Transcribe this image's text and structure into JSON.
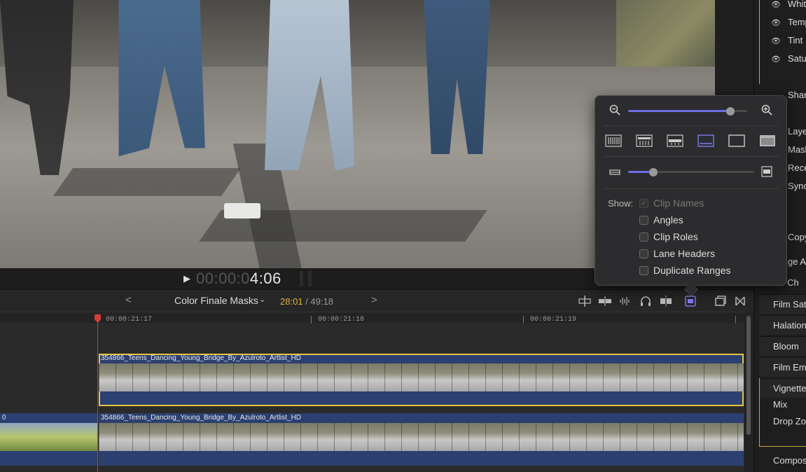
{
  "viewer": {
    "timecode_dim": "00:00:0",
    "timecode_bright": "4:06"
  },
  "toolbar": {
    "project_name": "Color Finale Masks",
    "duration_current": "28:01",
    "duration_separator": " / ",
    "duration_total": "49:18",
    "back_arrow": "<",
    "forward_arrow": ">",
    "chevron": "⌄"
  },
  "timeline": {
    "ruler": [
      "00:00:21:17",
      "00:00:21:18",
      "00:00:21:19"
    ],
    "clips": [
      {
        "title": "354866_Teens_Dancing_Young_Bridge_By_Azulroto_Artlist_HD"
      },
      {
        "title": "354866_Teens_Dancing_Young_Bridge_By_Azulroto_Artlist_HD"
      }
    ],
    "prev_clip_title": "0"
  },
  "inspector": {
    "rows_top": [
      "Whit",
      "Temp",
      "Tint",
      "Satu"
    ],
    "rows_mid": [
      "Shar",
      "Laye",
      "Mask",
      "Rece",
      "Sync"
    ],
    "row_copy": "Copy",
    "partial_rows": [
      "ge Ar",
      "or Ch"
    ],
    "sections": [
      "Film Satu",
      "Halation",
      "Bloom",
      "Film Emu",
      "Vignette"
    ],
    "sub_rows": [
      "Mix",
      "Drop Zon"
    ],
    "bottom": "Composi"
  },
  "popover": {
    "show_label": "Show:",
    "zoom_level": 0.86,
    "clip_height_level": 0.2,
    "options": [
      {
        "label": "Clip Names",
        "checked": true,
        "disabled": true
      },
      {
        "label": "Angles",
        "checked": false,
        "disabled": false
      },
      {
        "label": "Clip Roles",
        "checked": false,
        "disabled": false
      },
      {
        "label": "Lane Headers",
        "checked": false,
        "disabled": false
      },
      {
        "label": "Duplicate Ranges",
        "checked": false,
        "disabled": false
      }
    ]
  },
  "colors": {
    "accent": "#6f6de6",
    "selection": "#e6c441",
    "playhead": "#d43b3b",
    "clip": "#2b3f70",
    "duration_current": "#e3b33a"
  },
  "icons": [
    "play-icon",
    "zoom-out-icon",
    "zoom-in-icon",
    "headphones-icon",
    "snapping-icon",
    "clip-appearance-icon",
    "skimming-icon",
    "audio-skimming-icon",
    "solo-icon",
    "transitions-icon",
    "window-icon"
  ]
}
